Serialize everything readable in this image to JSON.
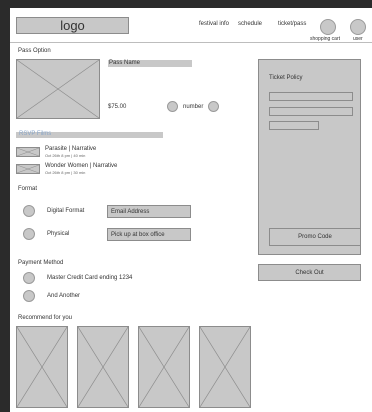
{
  "header": {
    "logo": "logo",
    "nav": [
      "festival info",
      "schedule",
      "ticket/pass"
    ],
    "shopping_cart": "shopping cart",
    "user": "user"
  },
  "pass_option": {
    "heading": "Pass Option",
    "pass_name": "Pass Name",
    "price": "$75.00",
    "number_label": "number"
  },
  "rsvp": {
    "heading": "RSVP Films",
    "films": [
      {
        "title": "Parasite | Narrative",
        "meta": "Oct 26th 8 pm | 40 min"
      },
      {
        "title": "Wonder Women | Narrative",
        "meta": "Oct 26th 8 pm | 30 min"
      }
    ]
  },
  "format": {
    "heading": "Format",
    "options": [
      {
        "label": "Digital Format",
        "field": "Email Address"
      },
      {
        "label": "Physical",
        "field": "Pick up at box office"
      }
    ]
  },
  "payment": {
    "heading": "Payment Method",
    "options": [
      "Master Credit Card ending 1234",
      "And Another"
    ]
  },
  "recommend": {
    "heading": "Recommend for you"
  },
  "ticket": {
    "policy_title": "Ticket Policy",
    "promo_code": "Promo Code",
    "checkout": "Check Out"
  },
  "colors": {
    "placeholder": "#c8c8c8",
    "stroke": "#8c8c8c",
    "accent": "#8aa6c8",
    "background": "#2b2b2b"
  }
}
